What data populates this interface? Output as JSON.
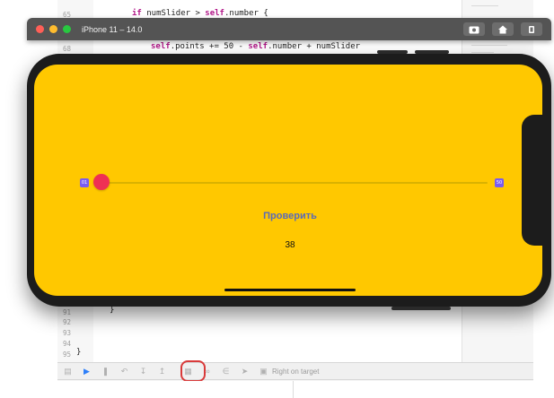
{
  "simulator": {
    "title": "iPhone 11 – 14.0",
    "buttons": [
      {
        "name": "screenshot-icon"
      },
      {
        "name": "home-icon"
      },
      {
        "name": "rotate-icon"
      }
    ]
  },
  "code": {
    "top_lines": [
      {
        "number": "65",
        "text": "if numSlider > self.number {"
      },
      {
        "number": "68",
        "text": "self.points += 50 - self.number + numSlider"
      }
    ],
    "bottom_lines": [
      {
        "number": "91",
        "text": "}"
      },
      {
        "number": "92",
        "text": ""
      },
      {
        "number": "93",
        "text": ""
      },
      {
        "number": "94",
        "text": ""
      },
      {
        "number": "95",
        "text": "}"
      }
    ]
  },
  "app": {
    "slider": {
      "min_label": "01",
      "max_label": "50",
      "value": 1,
      "min": 1,
      "max": 50
    },
    "check_button_label": "Проверить",
    "score": "38"
  },
  "debug_bar": {
    "location_label": "Right on target",
    "icons": [
      "hide-debug-area-icon",
      "breakpoints-icon",
      "pause-icon",
      "step-over-icon",
      "step-in-icon",
      "step-out-icon",
      "debug-view-hierarchy-icon",
      "memory-graph-icon",
      "environment-overrides-icon",
      "simulate-location-icon",
      "target-icon"
    ]
  },
  "colors": {
    "screen_bg": "#ffc800",
    "thumb": "#ef3054",
    "button_text": "#5a6ab8",
    "highlight": "#d93a3a"
  }
}
